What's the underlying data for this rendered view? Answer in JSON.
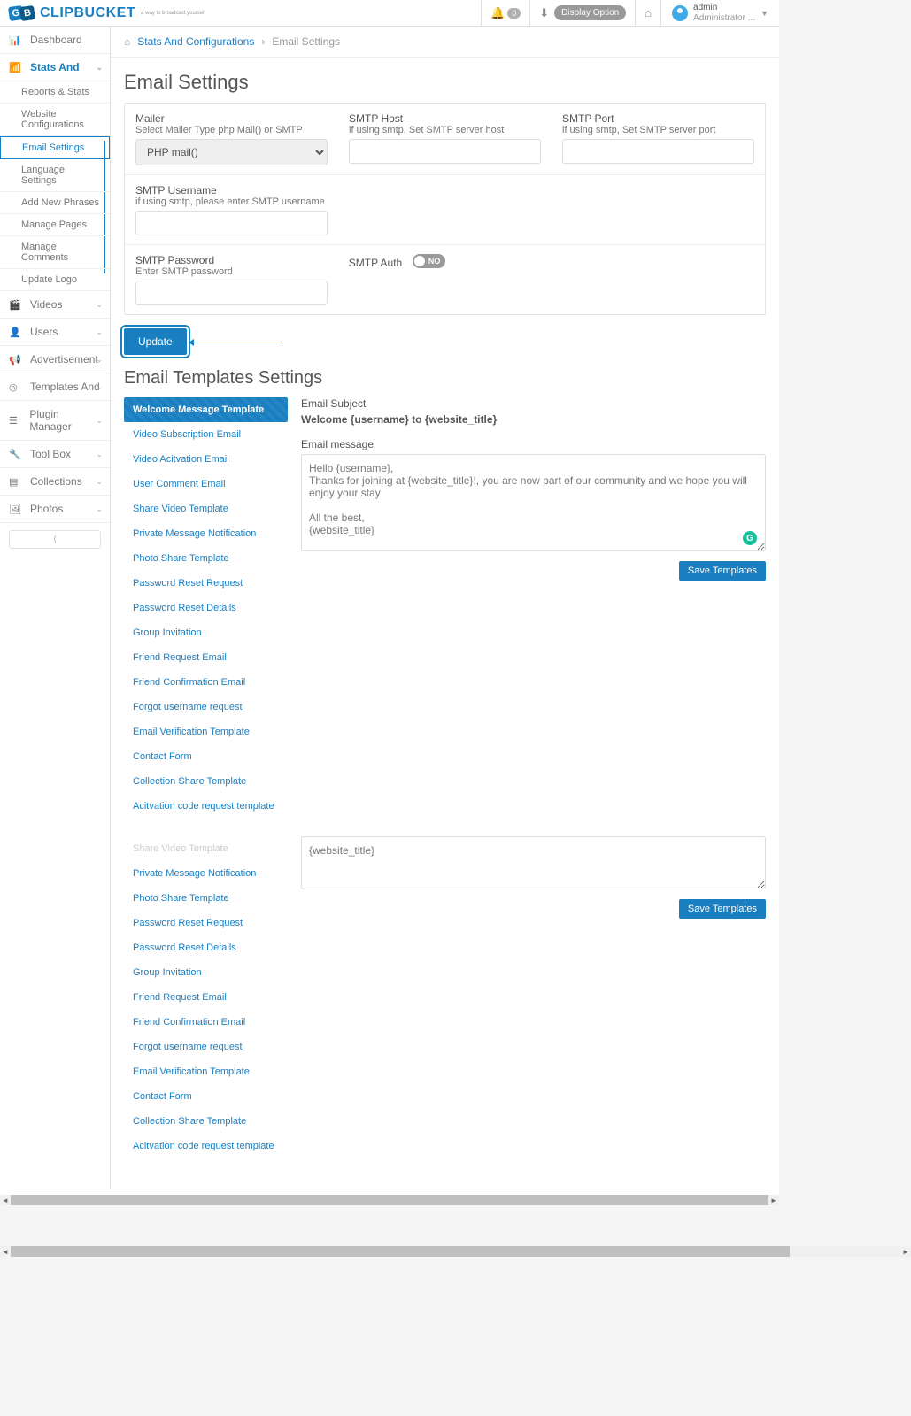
{
  "logo": {
    "text": "CLIPBUCKET",
    "sub": "a way to broadcast yourself"
  },
  "topbar": {
    "notifications": "0",
    "display_option": "Display Option",
    "user_name": "admin",
    "user_role": "Administrator ..."
  },
  "breadcrumb": {
    "root": "Stats And Configurations",
    "current": "Email Settings"
  },
  "sidebar": {
    "items": [
      {
        "label": "Dashboard",
        "icon": "dashboard"
      },
      {
        "label": "Stats And",
        "icon": "stats",
        "active": true,
        "expand": true
      },
      {
        "label": "Videos",
        "icon": "video",
        "expand": true
      },
      {
        "label": "Users",
        "icon": "user",
        "expand": true
      },
      {
        "label": "Advertisement",
        "icon": "megaphone",
        "expand": true
      },
      {
        "label": "Templates And",
        "icon": "target",
        "expand": true
      },
      {
        "label": "Plugin Manager",
        "icon": "list",
        "expand": true
      },
      {
        "label": "Tool Box",
        "icon": "wrench",
        "expand": true
      },
      {
        "label": "Collections",
        "icon": "folder",
        "expand": true
      },
      {
        "label": "Photos",
        "icon": "photo",
        "expand": true
      }
    ],
    "stats_sub": [
      "Reports & Stats",
      "Website Configurations",
      "Email Settings",
      "Language Settings",
      "Add New Phrases",
      "Manage Pages",
      "Manage Comments",
      "Update Logo"
    ]
  },
  "page": {
    "title": "Email Settings",
    "mailer_label": "Mailer",
    "mailer_hint": "Select Mailer Type php Mail() or SMTP",
    "mailer_value": "PHP mail()",
    "smtp_host_label": "SMTP Host",
    "smtp_host_hint": "if using smtp, Set SMTP server host",
    "smtp_port_label": "SMTP Port",
    "smtp_port_hint": "if using smtp, Set SMTP server port",
    "smtp_user_label": "SMTP Username",
    "smtp_user_hint": "if using smtp, please enter SMTP username",
    "smtp_pass_label": "SMTP Password",
    "smtp_pass_hint": "Enter SMTP password",
    "smtp_auth_label": "SMTP Auth",
    "smtp_auth_value": "NO",
    "update_btn": "Update"
  },
  "templates": {
    "title": "Email Templates Settings",
    "list": [
      "Welcome Message Template",
      "Video Subscription Email",
      "Video Acitvation Email",
      "User Comment Email",
      "Share Video Template",
      "Private Message Notification",
      "Photo Share Template",
      "Password Reset Request",
      "Password Reset Details",
      "Group Invitation",
      "Friend Request Email",
      "Friend Confirmation Email",
      "Forgot username request",
      "Email Verification Template",
      "Contact Form",
      "Collection Share Template",
      "Acitvation code request template"
    ],
    "list2": [
      "Share Video Template",
      "Private Message Notification",
      "Photo Share Template",
      "Password Reset Request",
      "Password Reset Details",
      "Group Invitation",
      "Friend Request Email",
      "Friend Confirmation Email",
      "Forgot username request",
      "Email Verification Template",
      "Contact Form",
      "Collection Share Template",
      "Acitvation code request template"
    ],
    "subject_label": "Email Subject",
    "subject_value": "Welcome {username} to {website_title}",
    "message_label": "Email message",
    "message_value": "Hello {username},\nThanks for joining at {website_title}!, you are now part of our community and we hope you will enjoy your stay\n\nAll the best,\n{website_title}",
    "message_value2": "{website_title}",
    "save_btn": "Save Templates"
  }
}
